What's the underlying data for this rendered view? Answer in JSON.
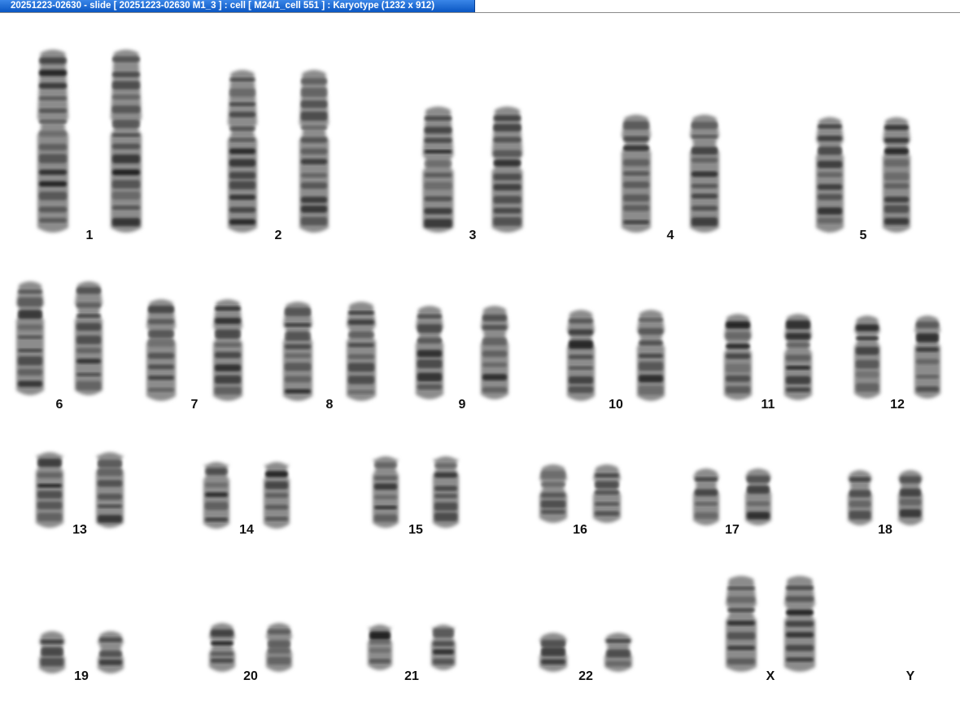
{
  "window": {
    "title": "20251223-02630 - slide [ 20251223-02630 M1_3 ] : cell [ M24/1_cell 551 ] : Karyotype  (1232 x 912)"
  },
  "karyotype": {
    "chromosomes": [
      {
        "label": "1",
        "count": 2
      },
      {
        "label": "2",
        "count": 2
      },
      {
        "label": "3",
        "count": 2
      },
      {
        "label": "4",
        "count": 2
      },
      {
        "label": "5",
        "count": 2
      },
      {
        "label": "6",
        "count": 2
      },
      {
        "label": "7",
        "count": 2
      },
      {
        "label": "8",
        "count": 2
      },
      {
        "label": "9",
        "count": 2
      },
      {
        "label": "10",
        "count": 2
      },
      {
        "label": "11",
        "count": 2
      },
      {
        "label": "12",
        "count": 2
      },
      {
        "label": "13",
        "count": 2
      },
      {
        "label": "14",
        "count": 2
      },
      {
        "label": "15",
        "count": 2
      },
      {
        "label": "16",
        "count": 2
      },
      {
        "label": "17",
        "count": 2
      },
      {
        "label": "18",
        "count": 2
      },
      {
        "label": "19",
        "count": 2
      },
      {
        "label": "20",
        "count": 2
      },
      {
        "label": "21",
        "count": 2
      },
      {
        "label": "22",
        "count": 2
      },
      {
        "label": "X",
        "count": 2
      },
      {
        "label": "Y",
        "count": 0
      }
    ]
  }
}
